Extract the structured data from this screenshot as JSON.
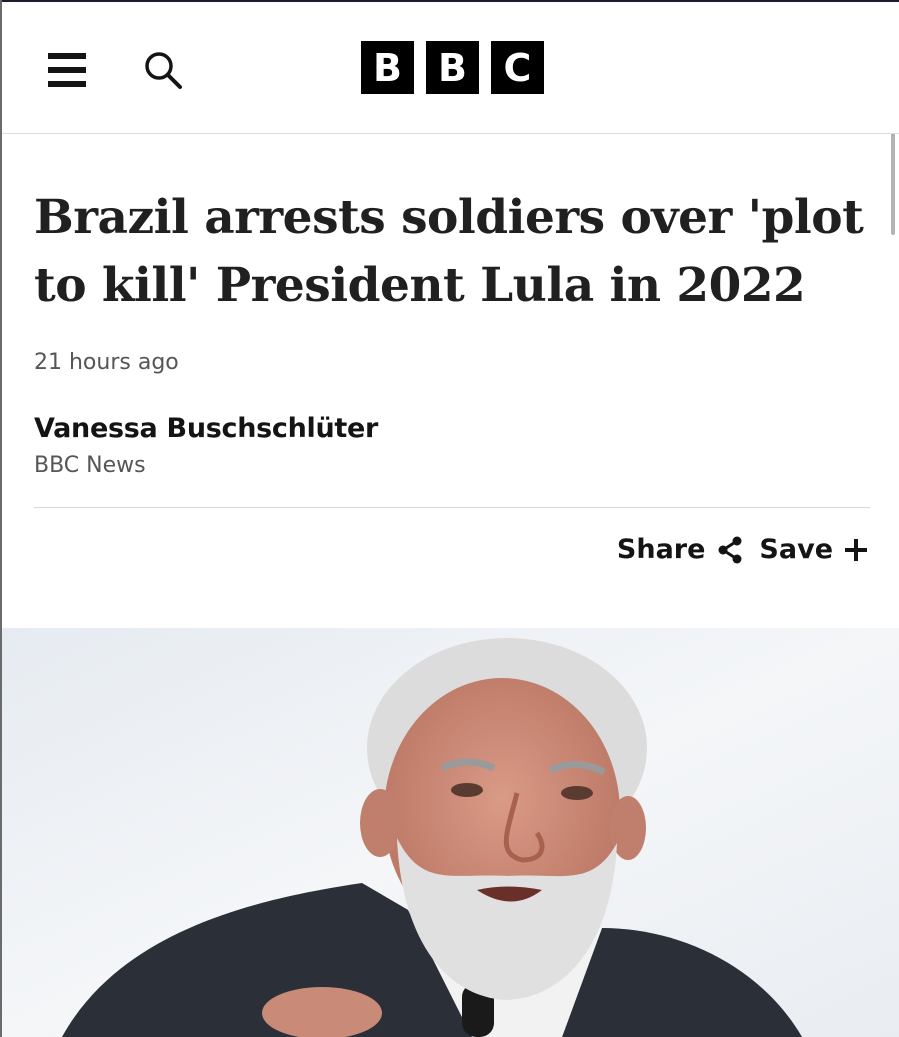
{
  "header": {
    "logo_letters": [
      "B",
      "B",
      "C"
    ],
    "menu_icon": "menu-icon",
    "search_icon": "search-icon"
  },
  "article": {
    "headline": "Brazil arrests soldiers over 'plot to kill' President Lula in 2022",
    "timestamp": "21 hours ago",
    "author": "Vanessa Buschschlüter",
    "organization": "BBC News"
  },
  "actions": {
    "share_label": "Share",
    "share_icon": "share-icon",
    "save_label": "Save",
    "save_icon": "plus-icon"
  },
  "image": {
    "subject": "photo",
    "colors": {
      "background": "#eef2f6",
      "suit": "#2b3038",
      "skin": "#c98a78",
      "hair": "#e4e4e4"
    }
  }
}
